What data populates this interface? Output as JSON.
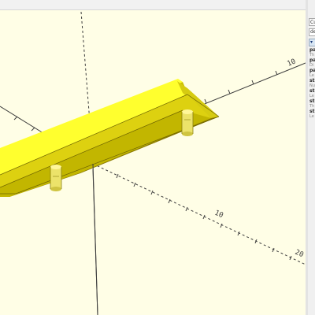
{
  "customizer": {
    "tab_label": "Cu",
    "preset_value": "de",
    "filter_label": "▾",
    "params": [
      {
        "name": "pa",
        "desc": "Th"
      },
      {
        "name": "pa",
        "desc": "Di"
      },
      {
        "name": "pa",
        "desc": "Le"
      },
      {
        "name": "st",
        "desc": "Nu"
      },
      {
        "name": "st",
        "desc": "Le"
      },
      {
        "name": "st",
        "desc": "Th"
      },
      {
        "name": "st",
        "desc": "Le"
      }
    ]
  },
  "viewport": {
    "axis_color": "#3c3c3c",
    "model_color_top": "#ffff2e",
    "model_color_side": "#ccc100",
    "model_color_dark": "#8a7a00",
    "post_color": "#ece36a",
    "tick_labels": [
      "10",
      "20",
      "10"
    ]
  }
}
